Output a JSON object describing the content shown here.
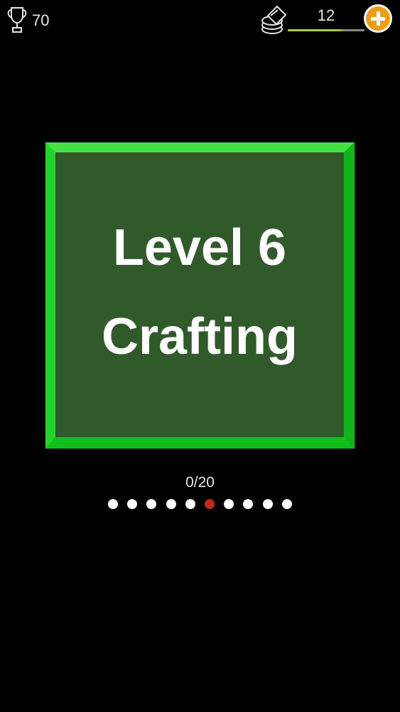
{
  "header": {
    "trophy_count": "70",
    "coins": "12",
    "coins_progress": 0.7
  },
  "level": {
    "title": "Level 6",
    "subtitle": "Crafting"
  },
  "progress": {
    "text": "0/20",
    "dot_count": 10,
    "active_index": 5
  },
  "colors": {
    "card_face": "#305a2a",
    "card_border": "#22d52a",
    "active_dot": "#c0281a",
    "inactive_dot": "#ffffff",
    "add_button": "#f39c12"
  },
  "icons": {
    "trophy": "trophy-icon",
    "hint": "hint-coins-icon",
    "add": "plus-icon"
  }
}
